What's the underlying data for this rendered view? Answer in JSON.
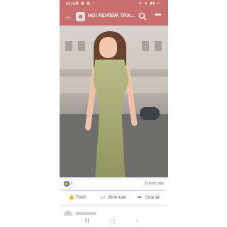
{
  "status": {
    "time": "04:19",
    "left_icons": "▣ ▣ ▦ •",
    "right_icons": "⊘ ▲ ▮▮ ▭"
  },
  "header": {
    "title": "HỘI REVIEW, TRA...",
    "back_icon": "arrow-left-icon",
    "search_icon": "search-icon",
    "more_icon": "more-icon"
  },
  "post": {
    "reaction_count": "3",
    "comment_count": "39 bình luận",
    "actions": [
      {
        "icon": "like-icon",
        "label": "Thích"
      },
      {
        "icon": "comment-icon",
        "label": "Bình luận"
      },
      {
        "icon": "share-icon",
        "label": "Chia sẻ"
      }
    ]
  },
  "colors": {
    "header_bg": "#c86f6d",
    "like_blue": "#3b6fe0"
  },
  "navbar": {
    "icons": [
      "menu-icon",
      "home-icon",
      "back-icon"
    ]
  }
}
